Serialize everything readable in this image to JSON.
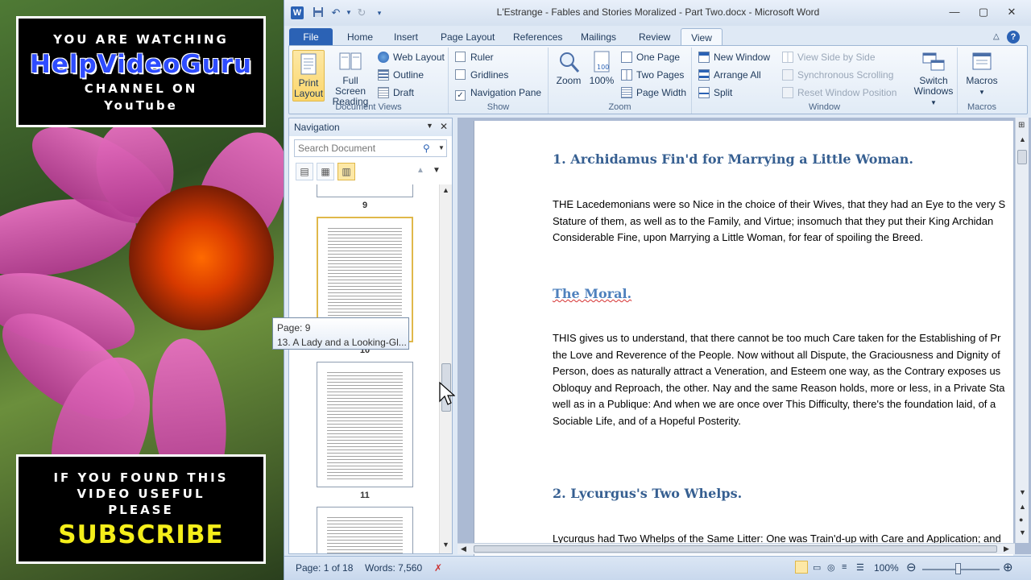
{
  "overlay": {
    "top_line1": "YOU ARE WATCHING",
    "top_brand": "HelpVideoGuru",
    "top_line3": "CHANNEL ON",
    "top_line4": "YouTube",
    "bottom_line1": "IF YOU FOUND THIS",
    "bottom_line2": "VIDEO USEFUL",
    "bottom_line3": "PLEASE",
    "bottom_cta": "SUBSCRIBE"
  },
  "window": {
    "title": "L'Estrange - Fables and Stories Moralized - Part Two.docx  -  Microsoft Word",
    "app_icon": "W"
  },
  "tabs": [
    "File",
    "Home",
    "Insert",
    "Page Layout",
    "References",
    "Mailings",
    "Review",
    "View"
  ],
  "ribbon": {
    "document_views": {
      "label": "Document Views",
      "print_layout": "Print Layout",
      "full_screen": "Full Screen Reading",
      "web_layout": "Web Layout",
      "outline": "Outline",
      "draft": "Draft"
    },
    "show": {
      "label": "Show",
      "ruler": "Ruler",
      "gridlines": "Gridlines",
      "navigation_pane": "Navigation Pane"
    },
    "zoom": {
      "label": "Zoom",
      "zoom": "Zoom",
      "hundred": "100%",
      "one_page": "One Page",
      "two_pages": "Two Pages",
      "page_width": "Page Width"
    },
    "window": {
      "label": "Window",
      "new_window": "New Window",
      "arrange_all": "Arrange All",
      "split": "Split",
      "view_side": "View Side by Side",
      "sync_scroll": "Synchronous Scrolling",
      "reset_pos": "Reset Window Position",
      "switch_windows": "Switch Windows"
    },
    "macros": {
      "label": "Macros",
      "macros": "Macros"
    }
  },
  "navigation": {
    "title": "Navigation",
    "search_placeholder": "Search Document",
    "page_labels": [
      "9",
      "10",
      "11"
    ],
    "tooltip_page": "Page: 9",
    "tooltip_heading": "13. A Lady and a Looking-Gl..."
  },
  "document": {
    "heading1": "1. Archidamus Fin'd for Marrying a Little Woman.",
    "para1": "THE Lacedemonians were so Nice in the choice of their Wives, that they had an Eye to the very S\nStature of them, as well as to the Family, and Virtue; insomuch that they put their King Archidan\nConsiderable Fine, upon Marrying a Little Woman, for fear of spoiling the Breed.",
    "moral": "The Moral.",
    "para2": "THIS gives us to understand, that there cannot be too much Care taken for the Establishing of Pr\nthe Love and Reverence of the People. Now without all Dispute, the Graciousness and Dignity of\nPerson, does as naturally attract a Veneration, and Esteem one way, as the Contrary exposes us\nObloquy and Reproach, the other. Nay and the same Reason holds, more or less, in a Private Sta\nwell as in a Publique: And when we are once over This Difficulty, there's the foundation laid, of a\nSociable Life, and of a Hopeful Posterity.",
    "heading2": "2. Lycurgus's Two Whelps.",
    "para3": "Lycurgus had Two Whelps of the Same Litter: One was Train'd-up with Care and Application; and"
  },
  "status": {
    "page": "Page: 1 of 18",
    "words": "Words: 7,560",
    "zoom": "100%"
  },
  "colors": {
    "accent": "#2b62b5",
    "heading": "#365f91"
  }
}
